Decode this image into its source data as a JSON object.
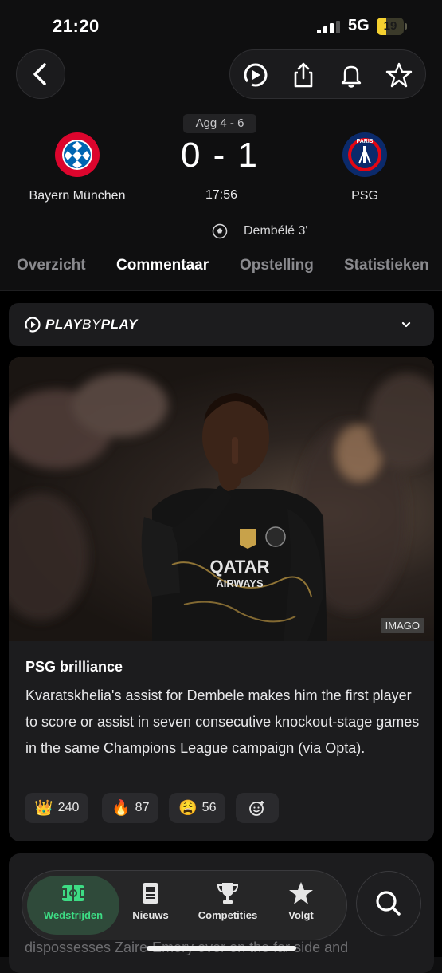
{
  "status_bar": {
    "time": "21:20",
    "network": "5G",
    "battery": "19",
    "battery_level": 0.19
  },
  "header": {
    "back_icon": "chevron-left-icon",
    "actions": [
      "play-icon",
      "share-icon",
      "bell-icon",
      "star-icon"
    ]
  },
  "match": {
    "aggregate": "Agg 4 - 6",
    "home": {
      "name": "Bayern München",
      "crest": "bayern-crest"
    },
    "away": {
      "name": "PSG",
      "crest": "psg-crest"
    },
    "score": "0 - 1",
    "clock": "17:56",
    "goal": "Dembélé 3'"
  },
  "tabs": [
    "Overzicht",
    "Commentaar",
    "Opstelling",
    "Statistieken"
  ],
  "active_tab": "Commentaar",
  "playbyplay": {
    "brand_bold": "PLAY",
    "brand_light": "BY",
    "brand_bold2": "PLAY"
  },
  "card": {
    "image_credit": "IMAGO",
    "title": "PSG brilliance",
    "body": "Kvaratskhelia's assist for Dembele makes him the first player to score or assist in seven consecutive knockout-stage games in the same Champions League campaign (via Opta).",
    "reactions": [
      {
        "emoji": "👑",
        "count": "240"
      },
      {
        "emoji": "🔥",
        "count": "87"
      },
      {
        "emoji": "😩",
        "count": "56"
      }
    ]
  },
  "card2": {
    "partial_text": "dispossesses Zaire-Emery over on the far side and"
  },
  "nav": {
    "items": [
      {
        "label": "Wedstrijden",
        "icon": "pitch-icon"
      },
      {
        "label": "Nieuws",
        "icon": "news-icon"
      },
      {
        "label": "Competities",
        "icon": "trophy-icon"
      },
      {
        "label": "Volgt",
        "icon": "star-icon"
      }
    ],
    "search_icon": "search-icon"
  },
  "colors": {
    "accent": "#3ddc84",
    "background": "#0f0f10",
    "card": "#1c1c1e"
  }
}
